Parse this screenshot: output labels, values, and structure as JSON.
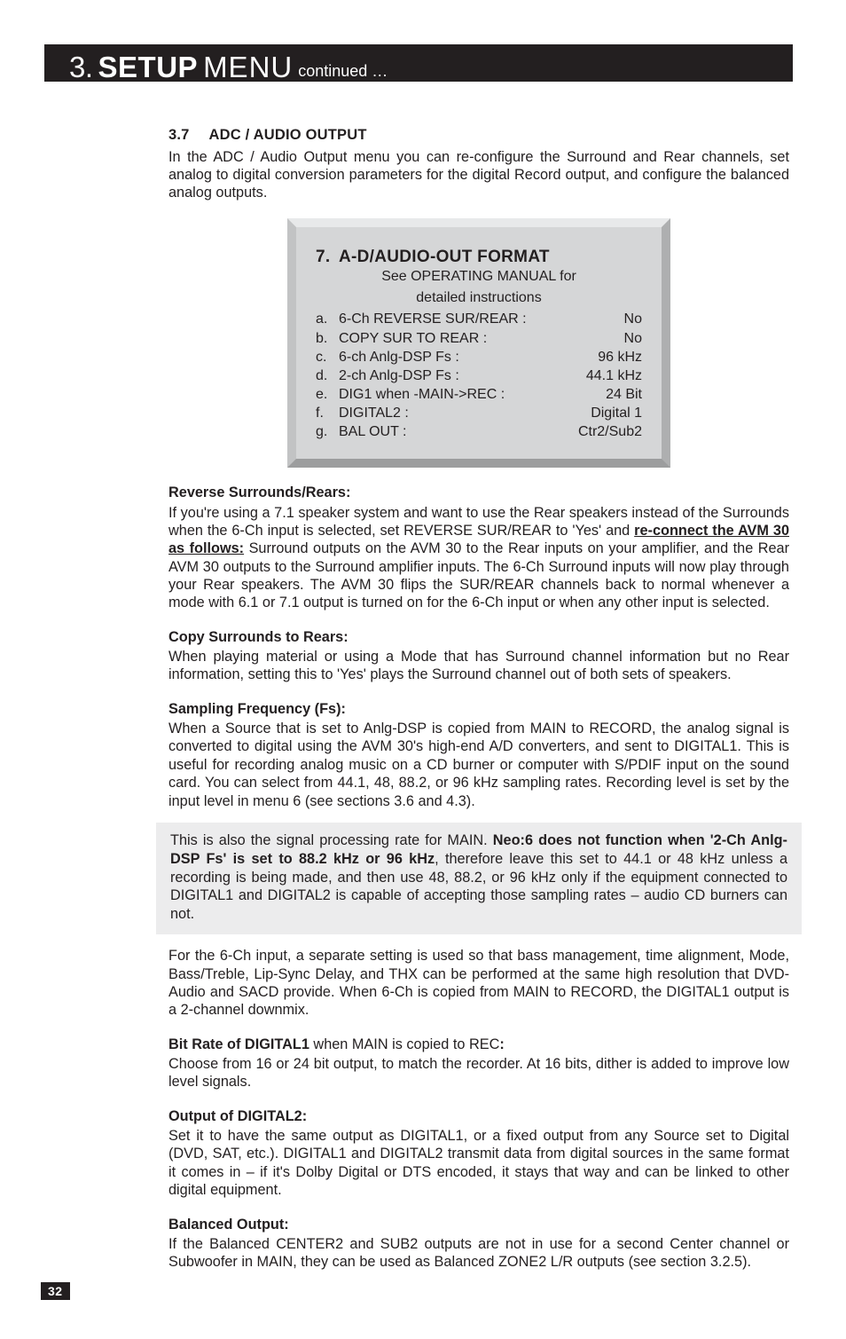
{
  "header": {
    "num": "3.",
    "setup": "SETUP",
    "menu": "MENU",
    "cont": "continued …"
  },
  "section": {
    "num": "3.7",
    "title": "ADC / AUDIO OUTPUT",
    "intro": "In the ADC / Audio Output menu you can re-configure the Surround and Rear channels, set analog to digital conversion parameters for the digital Record output, and configure the balanced analog outputs."
  },
  "panel": {
    "num": "7.",
    "title": "A-D/AUDIO-OUT FORMAT",
    "sub1": "See OPERATING MANUAL for",
    "sub2": "detailed instructions",
    "items": [
      {
        "k": "a.",
        "label": "6-Ch REVERSE SUR/REAR :",
        "value": "  No"
      },
      {
        "k": "b.",
        "label": "COPY SUR TO REAR :",
        "value": "   No"
      },
      {
        "k": "c.",
        "label": "6-ch Anlg-DSP Fs :",
        "value": "   96 kHz"
      },
      {
        "k": "d.",
        "label": "2-ch Anlg-DSP Fs :",
        "value": "   44.1 kHz"
      },
      {
        "k": "e.",
        "label": "DIG1 when -MAIN->REC :",
        "value": "  24 Bit"
      },
      {
        "k": "f.",
        "label": "DIGITAL2 :",
        "value": "   Digital 1"
      },
      {
        "k": "g.",
        "label": "BAL OUT :",
        "value": "   Ctr2/Sub2"
      }
    ]
  },
  "reverse": {
    "head": "Reverse Surrounds/Rears:",
    "p1a": "If you're using a 7.1 speaker system and want to use the Rear speakers instead of the Surrounds when the 6-Ch input is selected, set REVERSE SUR/REAR to 'Yes' and ",
    "p1u": "re-connect the AVM 30 as follows:",
    "p1b": " Surround outputs on the AVM 30 to the Rear inputs on your amplifier, and the Rear AVM 30 outputs to the Surround amplifier inputs. The 6-Ch Surround inputs will now play through your Rear speakers. The AVM 30 flips the SUR/REAR channels back to normal whenever a mode with 6.1 or 7.1 output is turned on for the 6-Ch input or when any other input is selected."
  },
  "copy": {
    "head": "Copy Surrounds to Rears:",
    "p": "When playing material or using a Mode that has Surround channel information but no Rear information, setting this to 'Yes' plays the Surround channel out of both sets of speakers."
  },
  "fs": {
    "head": "Sampling Frequency (Fs):",
    "p1": "When a Source that is set to Anlg-DSP is copied from MAIN to RECORD, the analog signal is converted to digital using the AVM 30's high-end A/D converters, and sent to DIGITAL1. This is useful for recording analog music on a CD burner or computer with S/PDIF input on the sound card. You can select from 44.1, 48, 88.2, or 96 kHz sampling rates. Recording level is set by the input level in menu 6 (see sections 3.6 and 4.3).",
    "note_a": "This is also the signal processing rate for MAIN. ",
    "note_b": "Neo:6 does not function when '2-Ch Anlg-DSP Fs' is set to 88.2 kHz or 96 kHz",
    "note_c": ", therefore leave this set to 44.1 or 48 kHz unless a recording is being made, and then use 48, 88.2, or 96 kHz only if the equipment connected to DIGITAL1 and DIGITAL2 is capable of accepting those sampling rates – audio CD burners can not.",
    "p2": "For the 6-Ch input, a separate setting is used so that bass management, time alignment, Mode, Bass/Treble, Lip-Sync Delay, and THX can be performed at the same high resolution that DVD-Audio and SACD provide. When 6-Ch is copied from MAIN to RECORD, the DIGITAL1 output is a 2-channel downmix."
  },
  "bitrate": {
    "head_b": "Bit Rate of DIGITAL1",
    "head_t": " when MAIN is copied to REC",
    "head_c": ":",
    "p": "Choose from 16 or 24 bit output, to match the recorder. At 16 bits, dither is added to improve low level signals."
  },
  "dig2": {
    "head": "Output of DIGITAL2:",
    "p": "Set it to have the same output as DIGITAL1, or a fixed output from any Source set to Digital (DVD, SAT, etc.). DIGITAL1 and DIGITAL2 transmit data from digital sources in the same format it comes in – if it's Dolby Digital or DTS encoded, it stays that way and can be linked to other digital equipment."
  },
  "balout": {
    "head": "Balanced Output:",
    "p": "If the Balanced CENTER2 and SUB2 outputs are not in use for a second Center channel or Subwoofer in MAIN, they can be used as Balanced ZONE2 L/R outputs (see section 3.2.5)."
  },
  "pagenum": "32"
}
